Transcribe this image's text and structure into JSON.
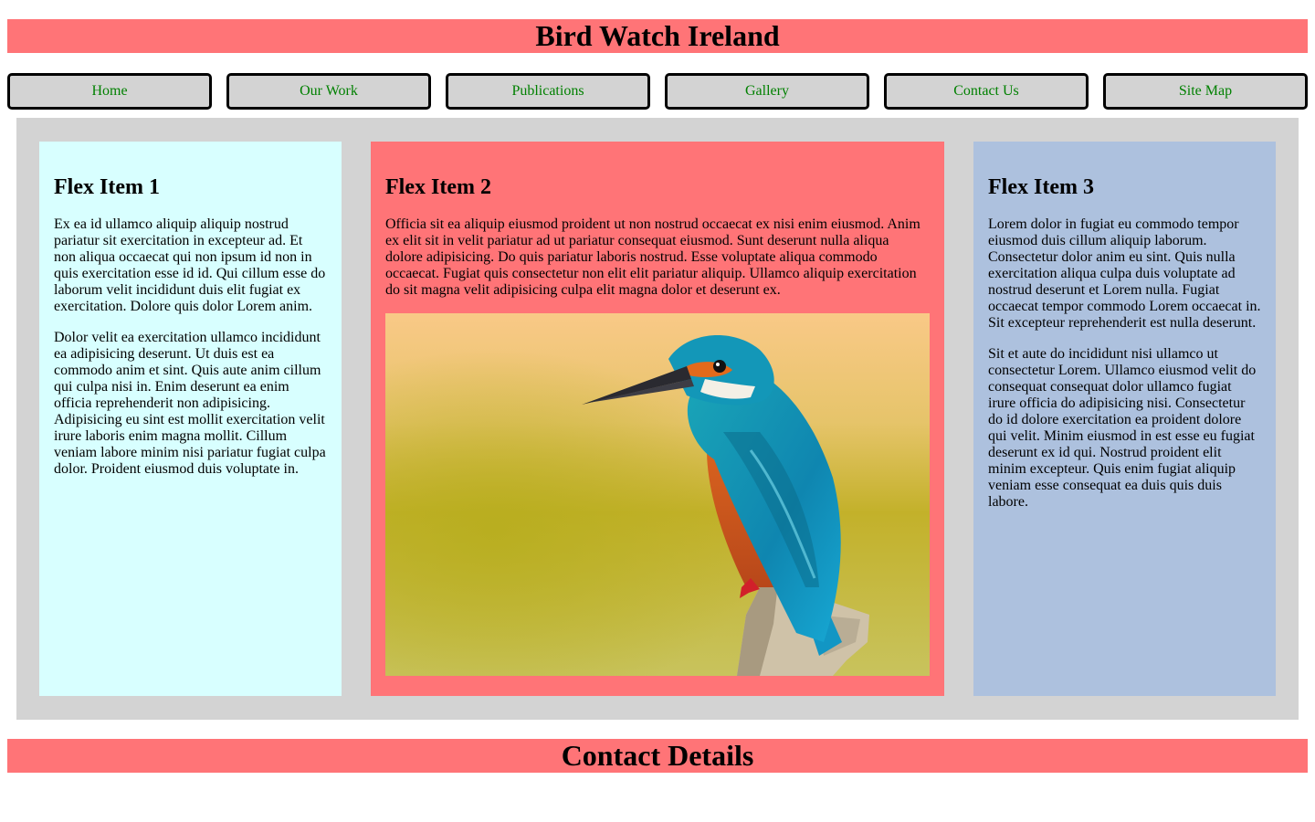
{
  "header": {
    "title": "Bird Watch Ireland"
  },
  "nav": {
    "items": [
      {
        "label": "Home"
      },
      {
        "label": "Our Work"
      },
      {
        "label": "Publications"
      },
      {
        "label": "Gallery"
      },
      {
        "label": "Contact Us"
      },
      {
        "label": "Site Map"
      }
    ]
  },
  "main": {
    "items": [
      {
        "heading": "Flex Item 1",
        "paragraphs": [
          "Ex ea id ullamco aliquip aliquip nostrud pariatur sit exercitation in excepteur ad. Et non aliqua occaecat qui non ipsum id non in quis exercitation esse id id. Qui cillum esse do laborum velit incididunt duis elit fugiat ex exercitation. Dolore quis dolor Lorem anim.",
          "Dolor velit ea exercitation ullamco incididunt ea adipisicing deserunt. Ut duis est ea commodo anim et sint. Quis aute anim cillum qui culpa nisi in. Enim deserunt ea enim officia reprehenderit non adipisicing. Adipisicing eu sint est mollit exercitation velit irure laboris enim magna mollit. Cillum veniam labore minim nisi pariatur fugiat culpa dolor. Proident eiusmod duis voluptate in."
        ]
      },
      {
        "heading": "Flex Item 2",
        "paragraphs": [
          "Officia sit ea aliquip eiusmod proident ut non nostrud occaecat ex nisi enim eiusmod. Anim ex elit sit in velit pariatur ad ut pariatur consequat eiusmod. Sunt deserunt nulla aliqua dolore adipisicing. Do quis pariatur laboris nostrud. Esse voluptate aliqua commodo occaecat. Fugiat quis consectetur non elit elit pariatur aliquip. Ullamco aliquip exercitation do sit magna velit adipisicing culpa elit magna dolor et deserunt ex."
        ],
        "image": "kingfisher"
      },
      {
        "heading": "Flex Item 3",
        "paragraphs": [
          "Lorem dolor in fugiat eu commodo tempor eiusmod duis cillum aliquip laborum. Consectetur dolor anim eu sint. Quis nulla exercitation aliqua culpa duis voluptate ad nostrud deserunt et Lorem nulla. Fugiat occaecat tempor commodo Lorem occaecat in. Sit excepteur reprehenderit est nulla deserunt.",
          "Sit et aute do incididunt nisi ullamco ut consectetur Lorem. Ullamco eiusmod velit do consequat consequat dolor ullamco fugiat irure officia do adipisicing nisi. Consectetur do id dolore exercitation ea proident dolore qui velit. Minim eiusmod in est esse eu fugiat deserunt ex id qui. Nostrud proident elit minim excepteur. Quis enim fugiat aliquip veniam esse consequat ea duis quis duis labore."
        ]
      }
    ]
  },
  "footer": {
    "title": "Contact Details"
  },
  "colors": {
    "banner": "#ff7477",
    "nav_button": "#d3d3d3",
    "nav_text": "#008000",
    "container": "#d3d3d3",
    "item1": "#d8ffff",
    "item2": "#ff7477",
    "item3": "#adc1de"
  }
}
